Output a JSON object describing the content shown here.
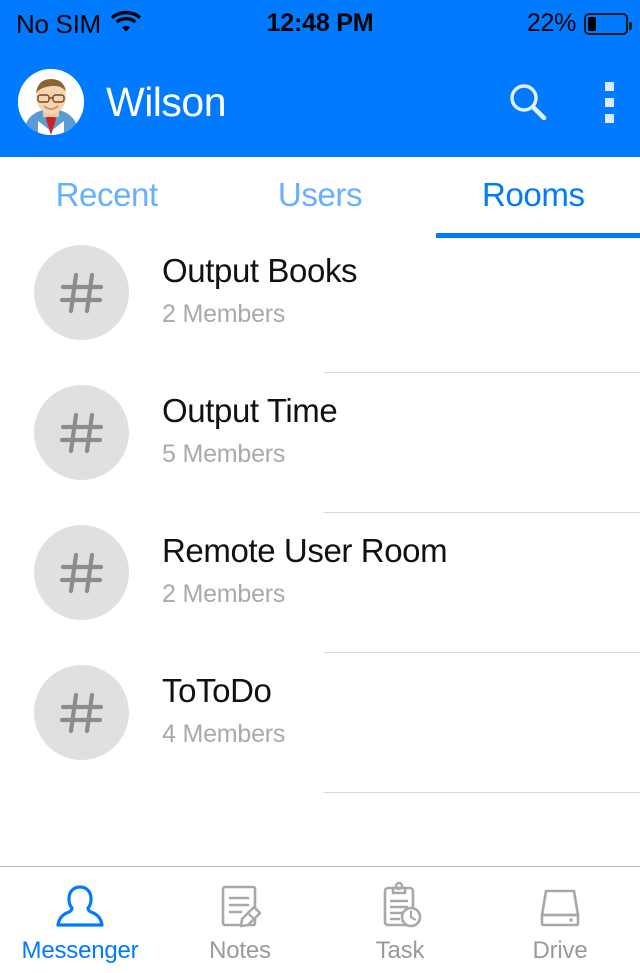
{
  "status_bar": {
    "carrier": "No SIM",
    "wifi_icon": "wifi-icon",
    "time": "12:48 PM",
    "battery_percent": "22%",
    "battery_level": 22,
    "battery_icon": "battery-icon",
    "text_color": "#000000"
  },
  "header": {
    "background": "#007BFF",
    "avatar_icon": "user-avatar-photo",
    "title": "Wilson",
    "search_icon": "search-icon",
    "menu_icon": "overflow-menu-icon"
  },
  "tabs": {
    "active_index": 2,
    "active_color": "#007BFF",
    "inactive_color": "#66B0FF",
    "items": [
      {
        "label": "Recent"
      },
      {
        "label": "Users"
      },
      {
        "label": "Rooms"
      }
    ]
  },
  "rooms": {
    "avatar_icon": "hash-icon",
    "items": [
      {
        "name": "Output Books",
        "members": "2 Members"
      },
      {
        "name": "Output Time",
        "members": "5 Members"
      },
      {
        "name": "Remote User Room",
        "members": "2 Members"
      },
      {
        "name": "ToToDo",
        "members": "4 Members"
      }
    ]
  },
  "bottom_nav": {
    "active_index": 0,
    "active_color": "#007BFF",
    "inactive_color": "#9A9A9A",
    "items": [
      {
        "label": "Messenger",
        "icon": "person-icon"
      },
      {
        "label": "Notes",
        "icon": "note-pencil-icon"
      },
      {
        "label": "Task",
        "icon": "clipboard-clock-icon"
      },
      {
        "label": "Drive",
        "icon": "hard-drive-icon"
      }
    ]
  }
}
